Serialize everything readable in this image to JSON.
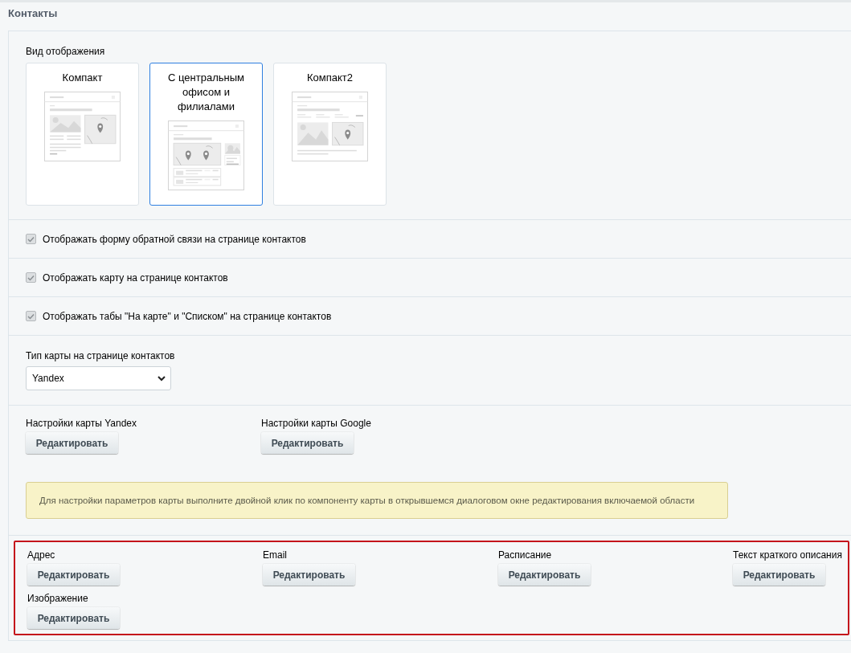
{
  "title": "Контакты",
  "view": {
    "label": "Вид отображения",
    "options": [
      {
        "label": "Компакт",
        "kind": "compact",
        "selected": false
      },
      {
        "label": "С центральным офисом и филиалами",
        "kind": "central",
        "selected": true
      },
      {
        "label": "Компакт2",
        "kind": "compact2",
        "selected": false
      }
    ]
  },
  "checkboxes": [
    {
      "label": "Отображать форму обратной связи на странице контактов",
      "checked": true
    },
    {
      "label": "Отображать карту на странице контактов",
      "checked": true
    },
    {
      "label": "Отображать табы \"На карте\" и \"Списком\" на странице контактов",
      "checked": true
    }
  ],
  "map_type": {
    "label": "Тип карты на странице контактов",
    "value": "Yandex"
  },
  "map_settings": [
    {
      "label": "Настройки карты Yandex",
      "button": "Редактировать"
    },
    {
      "label": "Настройки карты Google",
      "button": "Редактировать"
    }
  ],
  "notice": "Для настройки параметров карты выполните двойной клик по компоненту карты в открывшемся диалоговом окне редактирования включаемой области",
  "edit_fields": {
    "highlighted": true,
    "items": [
      {
        "label": "Адрес",
        "button": "Редактировать"
      },
      {
        "label": "Email",
        "button": "Редактировать"
      },
      {
        "label": "Расписание",
        "button": "Редактировать"
      },
      {
        "label": "Текст краткого описания",
        "button": "Редактировать"
      },
      {
        "label": "Изображение",
        "button": "Редактировать"
      }
    ]
  }
}
